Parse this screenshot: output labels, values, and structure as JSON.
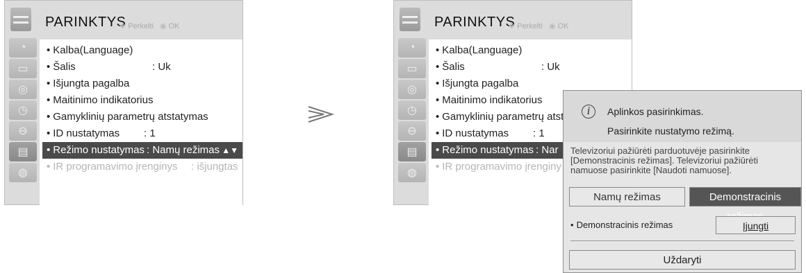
{
  "menu_left": {
    "title": "PARINKTYS",
    "hint_move_icon": "move-arrows-icon",
    "hint_move": "Perkelti",
    "hint_ok_icon": "ok-button-icon",
    "hint_ok": "OK",
    "items": [
      {
        "label": "Kalba(Language)",
        "value": ""
      },
      {
        "label": "Šalis",
        "value": ": Uk"
      },
      {
        "label": "Išjungta pagalba",
        "value": ""
      },
      {
        "label": "Maitinimo indikatorius",
        "value": ""
      },
      {
        "label": "Gamyklinių parametrų atstatymas",
        "value": ""
      },
      {
        "label": "ID nustatymas",
        "value": ": 1"
      },
      {
        "label": "Režimo nustatymas",
        "value": ": Namų režimas"
      },
      {
        "label": "IR programavimo įrenginys",
        "value": ": išjungtas"
      }
    ]
  },
  "menu_right": {
    "title": "PARINKTYS",
    "hint_move": "Perkelti",
    "hint_ok": "OK",
    "items": [
      {
        "label": "Kalba(Language)",
        "value": ""
      },
      {
        "label": "Šalis",
        "value": ": Uk"
      },
      {
        "label": "Išjungta pagalba",
        "value": ""
      },
      {
        "label": "Maitinimo indikatorius",
        "value": ""
      },
      {
        "label": "Gamyklinių parametrų atsta",
        "value": ""
      },
      {
        "label": "ID nustatymas",
        "value": ": 1"
      },
      {
        "label": "Režimo nustatymas",
        "value": ": Nar"
      },
      {
        "label": "IR programavimo įrenginy",
        "value": ""
      }
    ]
  },
  "dialog": {
    "title": "Aplinkos pasirinkimas.",
    "subtitle": "Pasirinkite nustatymo režimą.",
    "description": "Televizoriui pažiūrėti parduotuvėje pasirinkite [Demonstracinis režimas]. Televizoriui pažiūrėti namuose pasirinkite [Naudoti namuose].",
    "home_mode": "Namų režimas",
    "demo_mode": "Demonstracinis režimas",
    "demo_label": "Demonstracinis režimas",
    "demo_toggle": "Įjungti",
    "close": "Uždaryti"
  }
}
